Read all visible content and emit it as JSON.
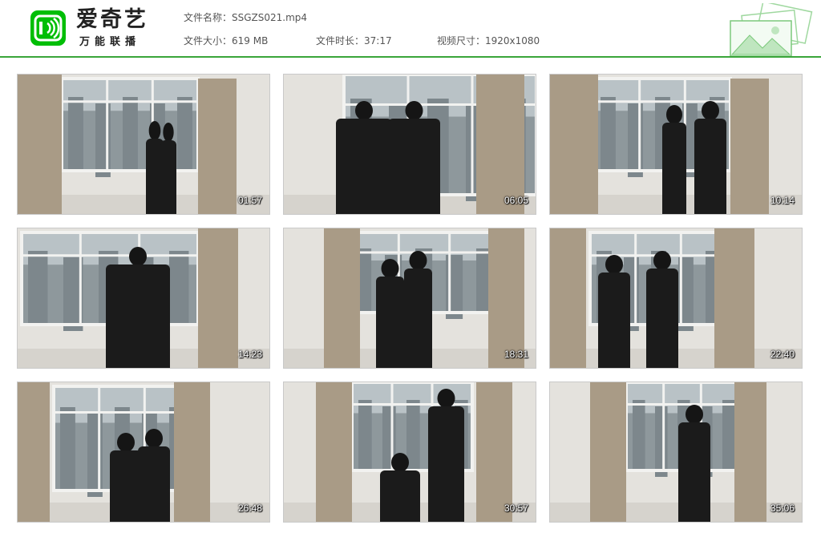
{
  "brand": {
    "name": "爱奇艺",
    "slogan": "万能联播",
    "logo_icon": "iqiyi-logo-icon",
    "accent": "#00be06"
  },
  "meta": {
    "filename_label": "文件名称：",
    "filename": "SSGZS021.mp4",
    "size_label": "文件大小：",
    "size": "619 MB",
    "duration_label": "文件时长：",
    "duration": "37:17",
    "resolution_label": "视频尺寸：",
    "resolution": "1920x1080"
  },
  "thumbnails": [
    {
      "timestamp": "01:57"
    },
    {
      "timestamp": "06:05"
    },
    {
      "timestamp": "10:14"
    },
    {
      "timestamp": "14:23"
    },
    {
      "timestamp": "18:31"
    },
    {
      "timestamp": "22:40"
    },
    {
      "timestamp": "26:48"
    },
    {
      "timestamp": "30:57"
    },
    {
      "timestamp": "35:06"
    }
  ]
}
